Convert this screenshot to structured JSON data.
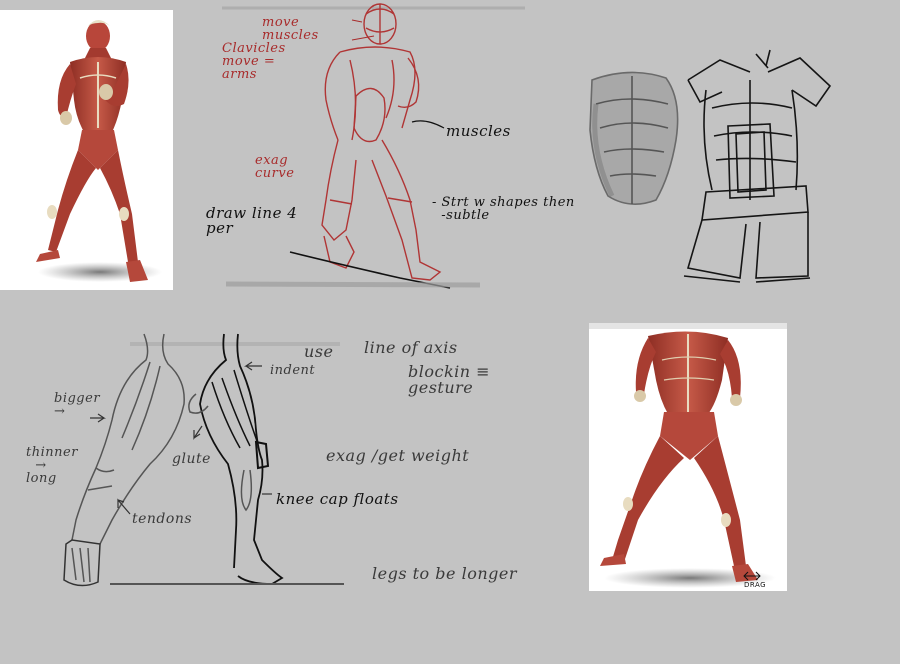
{
  "colors": {
    "background": "#c3c3c3",
    "note_red": "#a82b2b",
    "note_black": "#111111",
    "muscle_red": "#b8463a",
    "sketch_gray": "#4a4a4a"
  },
  "notes": {
    "move_muscles": "move\nmuscles",
    "clavicles": "Clavicles\nmove =\narms",
    "exag_curve": "exag\ncurve",
    "muscles": "muscles",
    "draw_line": "draw line 4\nper",
    "strt_shapes": "- Strt w shapes then\n  -subtle",
    "use": "use",
    "line_of_axis": "line of axis",
    "blockin": "blockin ≡\ngesture",
    "indent": "indent",
    "bigger": "bigger\n→",
    "thinner": "thinner\n  →\nlong",
    "glute": "glute",
    "exag_weight": "exag /get weight",
    "knee_cap": "knee cap floats",
    "tendons": "tendons",
    "legs_longer": "legs to be longer",
    "drag": "DRAG"
  }
}
